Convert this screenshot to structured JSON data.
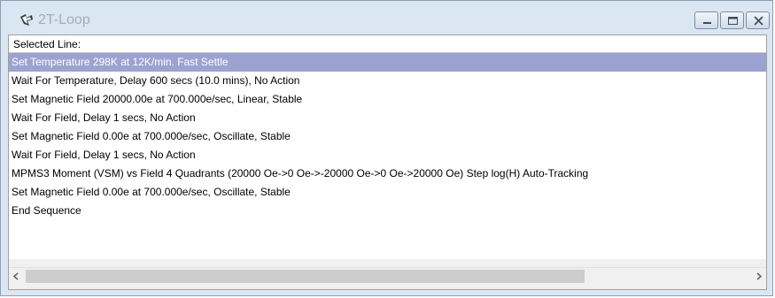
{
  "window": {
    "title": "2T-Loop",
    "app_icon": "sequence-app-icon",
    "controls": [
      "minimize-icon",
      "maximize-icon",
      "close-icon"
    ]
  },
  "header": {
    "label": "Selected Line:"
  },
  "sequence": {
    "selected_index": 0,
    "lines": [
      "Set Temperature 298K at 12K/min. Fast Settle",
      "Wait For Temperature, Delay 600 secs (10.0 mins), No Action",
      "Set Magnetic Field 20000.00e at 700.000e/sec, Linear, Stable",
      "Wait For Field, Delay 1 secs, No Action",
      "Set Magnetic Field 0.00e at 700.000e/sec, Oscillate, Stable",
      "Wait For Field, Delay 1 secs, No Action",
      "MPMS3 Moment (VSM) vs Field 4 Quadrants (20000 Oe->0 Oe->-20000 Oe->0 Oe->20000 Oe) Step  log(H)  Auto-Tracking",
      "Set Magnetic Field 0.00e at 700.000e/sec, Oscillate, Stable",
      "End Sequence"
    ]
  },
  "scrollbar": {
    "left_arrow": "chevron-left-icon",
    "right_arrow": "chevron-right-icon"
  },
  "colors": {
    "selection": "#9da3d0",
    "frame": "#dbe6f3"
  }
}
